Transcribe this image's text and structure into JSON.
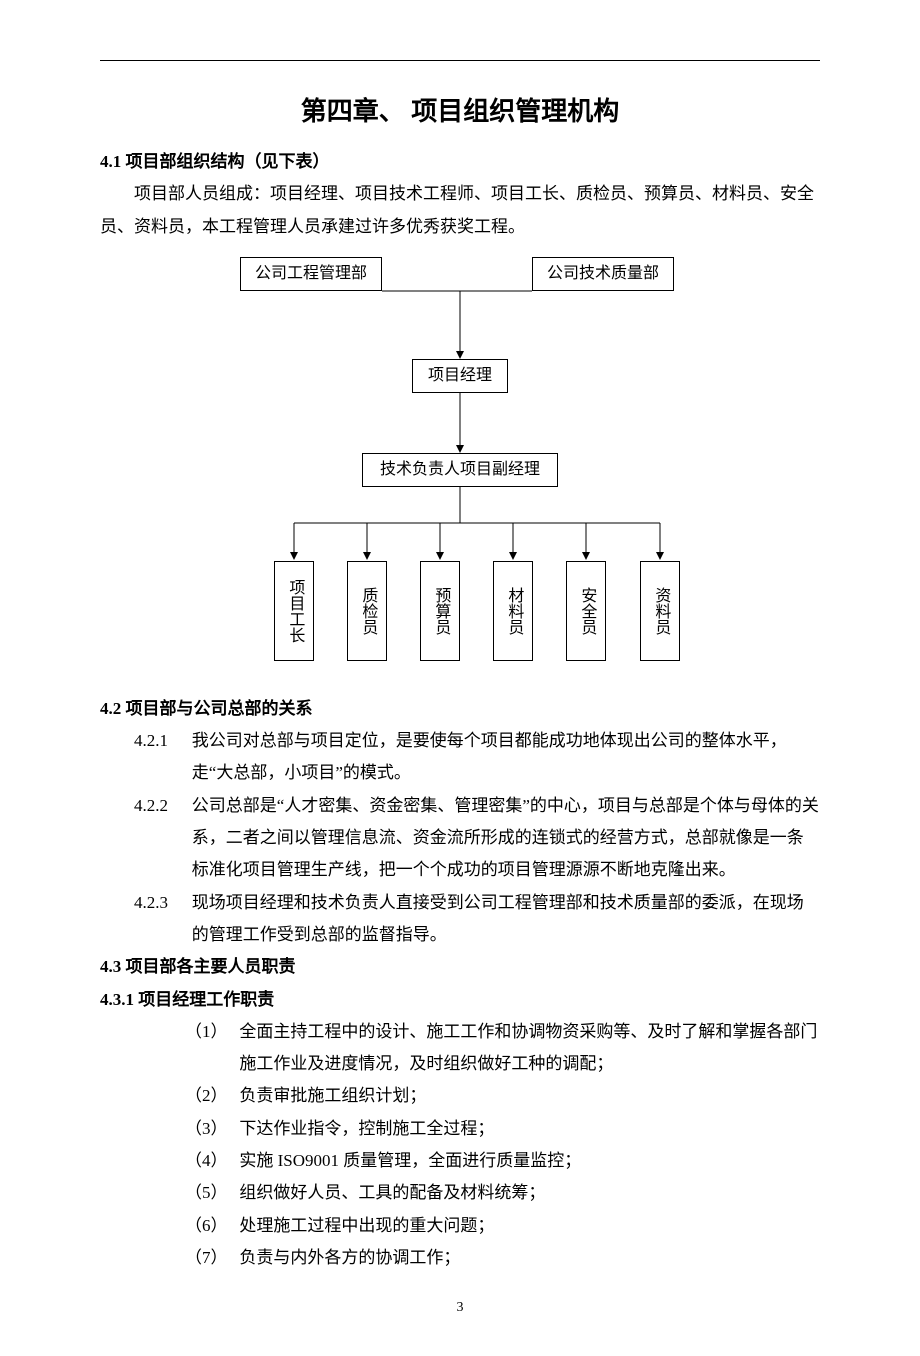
{
  "title": "第四章、  项目组织管理机构",
  "s41_label": "4.1 项目部组织结构（见下表）",
  "s41_body": "项目部人员组成：项目经理、项目技术工程师、项目工长、质检员、预算员、材料员、安全员、资料员，本工程管理人员承建过许多优秀获奖工程。",
  "chart": {
    "top_left": "公司工程管理部",
    "top_right": "公司技术质量部",
    "mid1": "项目经理",
    "mid2": "技术负责人项目副经理",
    "leaves": [
      "项目工长",
      "质检员",
      "预算员",
      "材料员",
      "安全员",
      "资料员"
    ]
  },
  "s42_label": "4.2 项目部与公司总部的关系",
  "s421_num": "4.2.1",
  "s421_txt": "我公司对总部与项目定位，是要使每个项目都能成功地体现出公司的整体水平，走“大总部，小项目”的模式。",
  "s422_num": "4.2.2",
  "s422_txt": "公司总部是“人才密集、资金密集、管理密集”的中心，项目与总部是个体与母体的关系，二者之间以管理信息流、资金流所形成的连锁式的经营方式，总部就像是一条标准化项目管理生产线，把一个个成功的项目管理源源不断地克隆出来。",
  "s423_num": "4.2.3",
  "s423_txt": "现场项目经理和技术负责人直接受到公司工程管理部和技术质量部的委派，在现场的管理工作受到总部的监督指导。",
  "s43_label": "4.3 项目部各主要人员职责",
  "s431_label": "4.3.1   项目经理工作职责",
  "d1_num": "（1）",
  "d1_txt": "全面主持工程中的设计、施工工作和协调物资采购等、及时了解和掌握各部门施工作业及进度情况，及时组织做好工种的调配；",
  "d2_num": "（2）",
  "d2_txt": "负责审批施工组织计划；",
  "d3_num": "（3）",
  "d3_txt": "下达作业指令，控制施工全过程；",
  "d4_num": "（4）",
  "d4_txt": "实施 ISO9001 质量管理，全面进行质量监控；",
  "d5_num": "（5）",
  "d5_txt": "组织做好人员、工具的配备及材料统筹；",
  "d6_num": "（6）",
  "d6_txt": "处理施工过程中出现的重大问题；",
  "d7_num": "（7）",
  "d7_txt": "负责与内外各方的协调工作；",
  "page_number": "3",
  "chart_data": {
    "type": "diagram",
    "title": "项目部组织结构",
    "nodes": [
      {
        "id": "a",
        "label": "公司工程管理部"
      },
      {
        "id": "b",
        "label": "公司技术质量部"
      },
      {
        "id": "c",
        "label": "项目经理"
      },
      {
        "id": "d",
        "label": "技术负责人项目副经理"
      },
      {
        "id": "e1",
        "label": "项目工长"
      },
      {
        "id": "e2",
        "label": "质检员"
      },
      {
        "id": "e3",
        "label": "预算员"
      },
      {
        "id": "e4",
        "label": "材料员"
      },
      {
        "id": "e5",
        "label": "安全员"
      },
      {
        "id": "e6",
        "label": "资料员"
      }
    ],
    "edges": [
      [
        "a",
        "c"
      ],
      [
        "b",
        "c"
      ],
      [
        "c",
        "d"
      ],
      [
        "d",
        "e1"
      ],
      [
        "d",
        "e2"
      ],
      [
        "d",
        "e3"
      ],
      [
        "d",
        "e4"
      ],
      [
        "d",
        "e5"
      ],
      [
        "d",
        "e6"
      ]
    ]
  }
}
